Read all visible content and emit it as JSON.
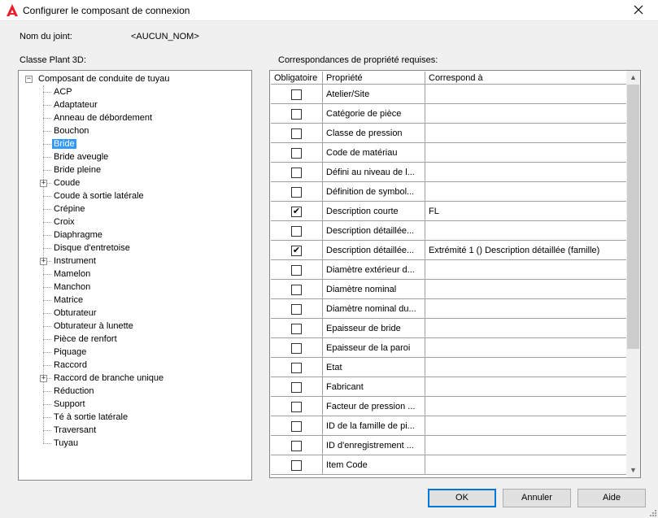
{
  "window": {
    "title": "Configurer le composant de connexion"
  },
  "joint": {
    "label": "Nom du joint:",
    "value": "<AUCUN_NOM>"
  },
  "class_panel": {
    "label": "Classe Plant 3D:",
    "root": "Composant de conduite de tuyau",
    "items": [
      {
        "label": "ACP",
        "expandable": false
      },
      {
        "label": "Adaptateur",
        "expandable": false
      },
      {
        "label": "Anneau de débordement",
        "expandable": false
      },
      {
        "label": "Bouchon",
        "expandable": false
      },
      {
        "label": "Bride",
        "expandable": false,
        "selected": true
      },
      {
        "label": "Bride aveugle",
        "expandable": false
      },
      {
        "label": "Bride pleine",
        "expandable": false
      },
      {
        "label": "Coude",
        "expandable": true
      },
      {
        "label": "Coude à sortie latérale",
        "expandable": false
      },
      {
        "label": "Crépine",
        "expandable": false
      },
      {
        "label": "Croix",
        "expandable": false
      },
      {
        "label": "Diaphragme",
        "expandable": false
      },
      {
        "label": "Disque d'entretoise",
        "expandable": false
      },
      {
        "label": "Instrument",
        "expandable": true
      },
      {
        "label": "Mamelon",
        "expandable": false
      },
      {
        "label": "Manchon",
        "expandable": false
      },
      {
        "label": "Matrice",
        "expandable": false
      },
      {
        "label": "Obturateur",
        "expandable": false
      },
      {
        "label": "Obturateur à lunette",
        "expandable": false
      },
      {
        "label": "Pièce de renfort",
        "expandable": false
      },
      {
        "label": "Piquage",
        "expandable": false
      },
      {
        "label": "Raccord",
        "expandable": false
      },
      {
        "label": "Raccord de branche unique",
        "expandable": true
      },
      {
        "label": "Réduction",
        "expandable": false
      },
      {
        "label": "Support",
        "expandable": false
      },
      {
        "label": "Té à sortie latérale",
        "expandable": false
      },
      {
        "label": "Traversant",
        "expandable": false
      },
      {
        "label": "Tuyau",
        "expandable": false
      }
    ]
  },
  "mapping_panel": {
    "label": "Correspondances de propriété requises:",
    "columns": [
      "Obligatoire",
      "Propriété",
      "Correspond à"
    ],
    "rows": [
      {
        "required": false,
        "property": "Atelier/Site",
        "maps_to": ""
      },
      {
        "required": false,
        "property": "Catégorie de pièce",
        "maps_to": ""
      },
      {
        "required": false,
        "property": "Classe de pression",
        "maps_to": ""
      },
      {
        "required": false,
        "property": "Code de matériau",
        "maps_to": ""
      },
      {
        "required": false,
        "property": "Défini au niveau de l...",
        "maps_to": ""
      },
      {
        "required": false,
        "property": "Définition de symbol...",
        "maps_to": ""
      },
      {
        "required": true,
        "property": "Description courte",
        "maps_to": "FL"
      },
      {
        "required": false,
        "property": "Description détaillée...",
        "maps_to": ""
      },
      {
        "required": true,
        "property": "Description détaillée...",
        "maps_to": "Extrémité 1 () Description détaillée (famille)"
      },
      {
        "required": false,
        "property": "Diamètre extérieur d...",
        "maps_to": ""
      },
      {
        "required": false,
        "property": "Diamètre nominal",
        "maps_to": ""
      },
      {
        "required": false,
        "property": "Diamètre nominal du...",
        "maps_to": ""
      },
      {
        "required": false,
        "property": "Epaisseur de bride",
        "maps_to": ""
      },
      {
        "required": false,
        "property": "Epaisseur de la paroi",
        "maps_to": ""
      },
      {
        "required": false,
        "property": "Etat",
        "maps_to": ""
      },
      {
        "required": false,
        "property": "Fabricant",
        "maps_to": ""
      },
      {
        "required": false,
        "property": "Facteur de pression ...",
        "maps_to": ""
      },
      {
        "required": false,
        "property": "ID de la famille de pi...",
        "maps_to": ""
      },
      {
        "required": false,
        "property": "ID d'enregistrement ...",
        "maps_to": ""
      },
      {
        "required": false,
        "property": "Item Code",
        "maps_to": ""
      }
    ]
  },
  "buttons": {
    "ok": "OK",
    "cancel": "Annuler",
    "help": "Aide"
  },
  "glyphs": {
    "check": "✔",
    "minus": "−",
    "plus": "+",
    "up": "▲",
    "down": "▼"
  },
  "colors": {
    "selection": "#3399ff",
    "app_icon": "#e8202c"
  },
  "icons": {
    "app": "autocad-logo-icon",
    "close": "close-icon"
  }
}
